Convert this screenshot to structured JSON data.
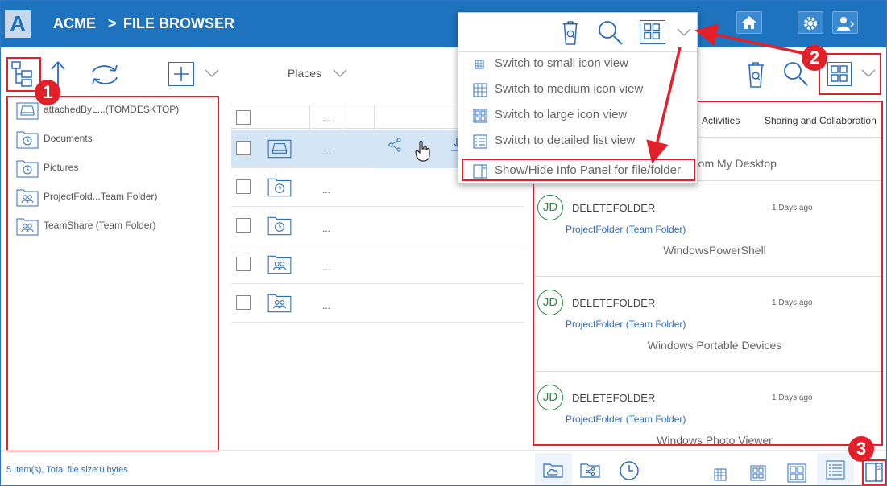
{
  "header": {
    "logo_letter": "A",
    "brand": "ACME",
    "separator": ">",
    "title": "FILE BROWSER",
    "icons": [
      "home-icon",
      "gear-icon",
      "user-icon"
    ]
  },
  "toolbar": {
    "places_label": "Places",
    "icons": [
      "tree-view-icon",
      "up-arrow-icon",
      "sync-icon",
      "add-icon",
      "chevron-down-icon"
    ]
  },
  "tree": {
    "items": [
      {
        "label": "attachedByL...(TOMDESKTOP)",
        "icon": "drive-icon"
      },
      {
        "label": "Documents",
        "icon": "history-folder-icon"
      },
      {
        "label": "Pictures",
        "icon": "history-folder-icon"
      },
      {
        "label": "ProjectFold...Team Folder)",
        "icon": "team-folder-icon"
      },
      {
        "label": "TeamShare (Team Folder)",
        "icon": "team-folder-icon"
      }
    ]
  },
  "filelist": {
    "header_dots": "...",
    "rows": [
      {
        "icon": "drive-icon",
        "dots": "..."
      },
      {
        "icon": "history-folder-icon",
        "dots": "..."
      },
      {
        "icon": "history-folder-icon",
        "dots": "..."
      },
      {
        "icon": "team-folder-icon",
        "dots": "..."
      },
      {
        "icon": "team-folder-icon",
        "dots": "..."
      }
    ]
  },
  "view_menu": {
    "items": [
      {
        "label": "Switch to small icon view",
        "icon": "small-icon-view-icon"
      },
      {
        "label": "Switch to medium icon view",
        "icon": "medium-icon-view-icon"
      },
      {
        "label": "Switch to large icon view",
        "icon": "large-icon-view-icon"
      },
      {
        "label": "Switch to detailed list view",
        "icon": "list-view-icon"
      },
      {
        "label": "Show/Hide Info Panel for file/folder",
        "icon": "info-panel-icon"
      }
    ]
  },
  "info_panel": {
    "tabs": [
      "Activities",
      "Sharing and Collaboration"
    ],
    "partial_first": "rom My Desktop",
    "activities": [
      {
        "initials": "JD",
        "action": "DELETEFOLDER",
        "when": "1 Days ago",
        "folder": "ProjectFolder (Team Folder)",
        "file": "WindowsPowerShell"
      },
      {
        "initials": "JD",
        "action": "DELETEFOLDER",
        "when": "1 Days ago",
        "folder": "ProjectFolder (Team Folder)",
        "file": "Windows Portable Devices"
      },
      {
        "initials": "JD",
        "action": "DELETEFOLDER",
        "when": "1 Days ago",
        "folder": "ProjectFolder (Team Folder)",
        "file": "Windows Photo Viewer"
      }
    ]
  },
  "status": {
    "text": "5 Item(s), Total file size:0 bytes"
  },
  "badges": [
    "1",
    "2",
    "3"
  ],
  "colors": {
    "header": "#1e73be",
    "annotation": "#e2202a",
    "link": "#2b6cc0",
    "avatar": "#2e8b3f"
  }
}
